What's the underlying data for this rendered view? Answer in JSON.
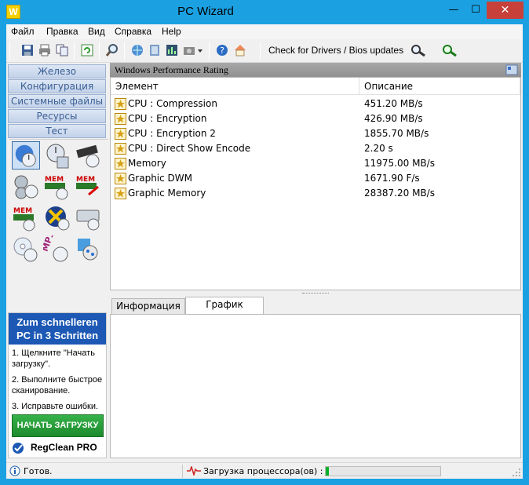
{
  "window": {
    "title": "PC Wizard",
    "app_icon_letter": "W",
    "min_glyph": "—",
    "max_glyph": "☐",
    "close_glyph": "✕"
  },
  "menu": [
    "Файл",
    "Правка",
    "Вид",
    "Справка",
    "Help"
  ],
  "toolbar": {
    "icons": [
      "save-icon",
      "print-icon",
      "copy-icon",
      "refresh-icon",
      "search-icon",
      "network-icon",
      "report-icon",
      "benchmark-icon",
      "screenshot-icon",
      "help-icon",
      "home-icon"
    ],
    "driver_label": "Check for Drivers / Bios updates"
  },
  "sidebar": {
    "categories": [
      "Железо",
      "Конфигурация",
      "Системные файлы",
      "Ресурсы",
      "Тест"
    ],
    "test_icons": [
      "performance-rating-icon",
      "cpu-benchmark-icon",
      "memory-benchmark-icon",
      "cpu-multithread-icon",
      "memory-read-icon",
      "memory-write-icon",
      "memory-latency-icon",
      "video-benchmark-icon",
      "hdd-benchmark-icon",
      "cdrom-benchmark-icon",
      "mp3-benchmark-icon",
      "directx-benchmark-icon"
    ]
  },
  "ad": {
    "header_line1": "Zum schnelleren",
    "header_line2": "PC in 3 Schritten",
    "steps": [
      "1. Щелкните \"Начать загрузку\".",
      "2. Выполните быстрое сканирование.",
      "3. Исправьте ошибки."
    ],
    "cta": "НАЧАТЬ ЗАГРУЗКУ",
    "brand": "RegClean PRO"
  },
  "main": {
    "header": "Windows Performance Rating",
    "columns": [
      "Элемент",
      "Описание"
    ],
    "rows": [
      {
        "name": "CPU : Compression",
        "value": "451.20 MB/s"
      },
      {
        "name": "CPU : Encryption",
        "value": "426.90 MB/s"
      },
      {
        "name": "CPU : Encryption 2",
        "value": "1855.70 MB/s"
      },
      {
        "name": "CPU : Direct Show Encode",
        "value": "2.20 s"
      },
      {
        "name": "Memory",
        "value": "11975.00 MB/s"
      },
      {
        "name": "Graphic DWM",
        "value": "1671.90 F/s"
      },
      {
        "name": "Graphic Memory",
        "value": "28387.20 MB/s"
      }
    ],
    "tabs": [
      "Информация",
      "График"
    ],
    "active_tab": "График"
  },
  "status": {
    "text": "Готов.",
    "cpu_label": "Загрузка процессора(ов) : 3",
    "cpu_percent": 3
  },
  "colors": {
    "title_bar": "#1ba1e2",
    "close_button": "#c7413a",
    "category_text": "#3a5f94",
    "ad_header": "#1c58b4",
    "cta": "#2aa03c",
    "cpu_bar": "#06b025"
  }
}
